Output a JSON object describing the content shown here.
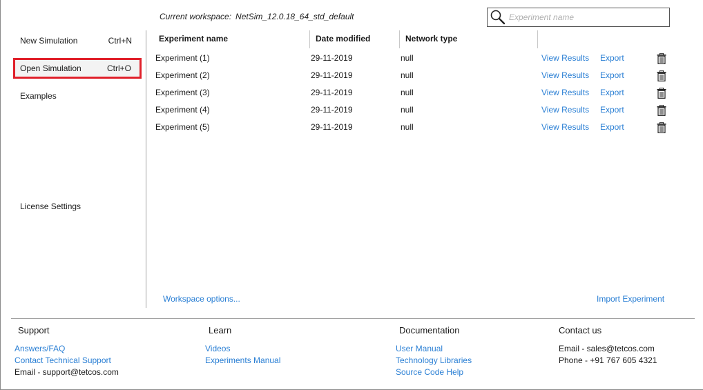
{
  "workspace": {
    "label": "Current workspace:",
    "name": "NetSim_12.0.18_64_std_default"
  },
  "search": {
    "placeholder": "Experiment name",
    "value": ""
  },
  "sidebar": {
    "items": [
      {
        "label": "New Simulation",
        "shortcut": "Ctrl+N"
      },
      {
        "label": "Open Simulation",
        "shortcut": "Ctrl+O"
      },
      {
        "label": "Examples",
        "shortcut": ""
      },
      {
        "label": "License Settings",
        "shortcut": ""
      }
    ],
    "selected": "Open Simulation"
  },
  "table": {
    "columns": [
      "Experiment name",
      "Date modified",
      "Network type"
    ],
    "rows": [
      {
        "name": "Experiment (1)",
        "date": "29-11-2019",
        "network": "null",
        "view": "View Results",
        "export": "Export"
      },
      {
        "name": "Experiment (2)",
        "date": "29-11-2019",
        "network": "null",
        "view": "View Results",
        "export": "Export"
      },
      {
        "name": "Experiment (3)",
        "date": "29-11-2019",
        "network": "null",
        "view": "View Results",
        "export": "Export"
      },
      {
        "name": "Experiment (4)",
        "date": "29-11-2019",
        "network": "null",
        "view": "View Results",
        "export": "Export"
      },
      {
        "name": "Experiment (5)",
        "date": "29-11-2019",
        "network": "null",
        "view": "View Results",
        "export": "Export"
      }
    ]
  },
  "actions": {
    "workspace_options": "Workspace options...",
    "import_experiment": "Import Experiment"
  },
  "footer": {
    "support": {
      "title": "Support",
      "answers": "Answers/FAQ",
      "contact": "Contact Technical Support",
      "email": "Email - support@tetcos.com"
    },
    "learn": {
      "title": "Learn",
      "videos": "Videos",
      "manual": "Experiments Manual"
    },
    "documentation": {
      "title": "Documentation",
      "user_manual": "User Manual",
      "tech_libs": "Technology Libraries",
      "source_help": "Source Code Help"
    },
    "contact": {
      "title": "Contact us",
      "email": "Email - sales@tetcos.com",
      "phone": "Phone - +91 767 605 4321"
    }
  },
  "colors": {
    "link": "#2a7fd4",
    "selection_border": "#e0202a",
    "divider": "#a0a0a0"
  },
  "icons": {
    "search": "magnifier-icon",
    "delete": "trash-icon"
  }
}
